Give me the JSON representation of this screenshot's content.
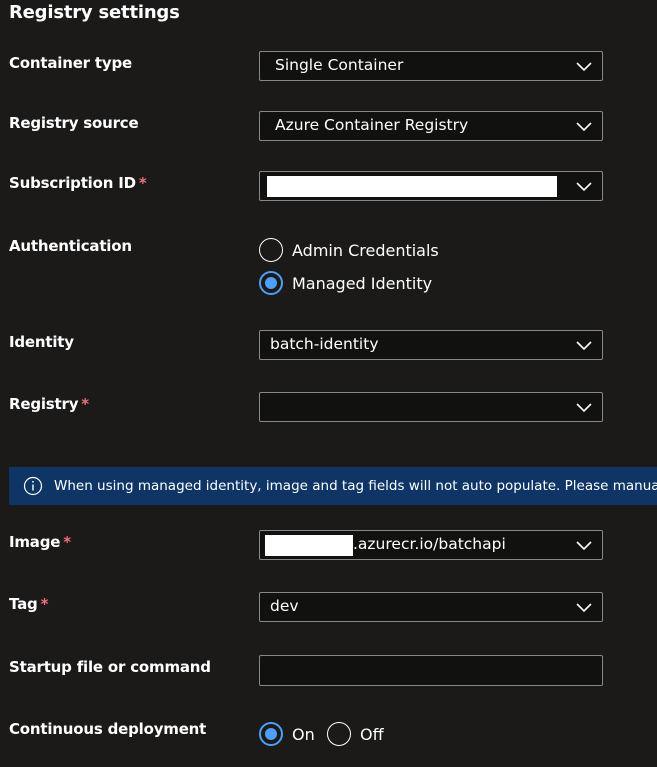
{
  "section_title": "Registry settings",
  "required_mark": "*",
  "container_type": {
    "label": "Container type",
    "value": "Single Container"
  },
  "registry_source": {
    "label": "Registry source",
    "value": "Azure Container Registry"
  },
  "subscription_id": {
    "label": "Subscription ID",
    "value": ""
  },
  "authentication": {
    "label": "Authentication",
    "options": [
      "Admin Credentials",
      "Managed Identity"
    ],
    "selected": "Managed Identity"
  },
  "identity": {
    "label": "Identity",
    "value": "batch-identity"
  },
  "registry": {
    "label": "Registry",
    "value": ""
  },
  "info_banner": {
    "text": "When using managed identity, image and tag fields will not auto populate. Please manually"
  },
  "image": {
    "label": "Image",
    "value_suffix": ".azurecr.io/batchapi"
  },
  "tag": {
    "label": "Tag",
    "value": "dev"
  },
  "startup": {
    "label": "Startup file or command",
    "value": ""
  },
  "continuous_deployment": {
    "label": "Continuous deployment",
    "options": [
      "On",
      "Off"
    ],
    "selected": "On"
  },
  "colors": {
    "background": "#1b1a19",
    "accent": "#4f9ef8",
    "banner": "#0e3565",
    "required": "#f1707b",
    "border": "#8a8886"
  }
}
